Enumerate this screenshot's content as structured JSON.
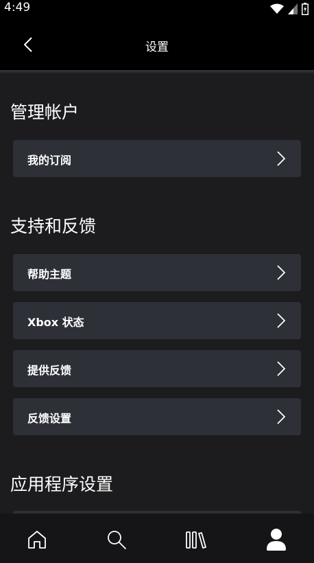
{
  "status_bar": {
    "time": "4:49",
    "icons": [
      "wifi-icon",
      "signal-icon",
      "battery-icon"
    ]
  },
  "app_bar": {
    "title": "设置",
    "back_icon": "chevron-left-icon"
  },
  "sections": [
    {
      "title": "管理帐户",
      "items": [
        {
          "label": "我的订阅",
          "icon": "chevron-right-icon"
        }
      ]
    },
    {
      "title": "支持和反馈",
      "items": [
        {
          "label": "帮助主题",
          "icon": "chevron-right-icon"
        },
        {
          "label": "Xbox 状态",
          "icon": "chevron-right-icon"
        },
        {
          "label": "提供反馈",
          "icon": "chevron-right-icon"
        },
        {
          "label": "反馈设置",
          "icon": "chevron-right-icon"
        }
      ]
    },
    {
      "title": "应用程序设置",
      "items": []
    }
  ],
  "bottom_nav": {
    "items": [
      {
        "name": "home",
        "icon": "home-icon"
      },
      {
        "name": "search",
        "icon": "search-icon"
      },
      {
        "name": "library",
        "icon": "library-icon"
      },
      {
        "name": "profile",
        "icon": "profile-icon",
        "active": true
      }
    ]
  },
  "colors": {
    "background": "#1c1c1e",
    "header": "#000000",
    "row": "#2e3038",
    "nav": "#151517",
    "text": "#ffffff"
  }
}
